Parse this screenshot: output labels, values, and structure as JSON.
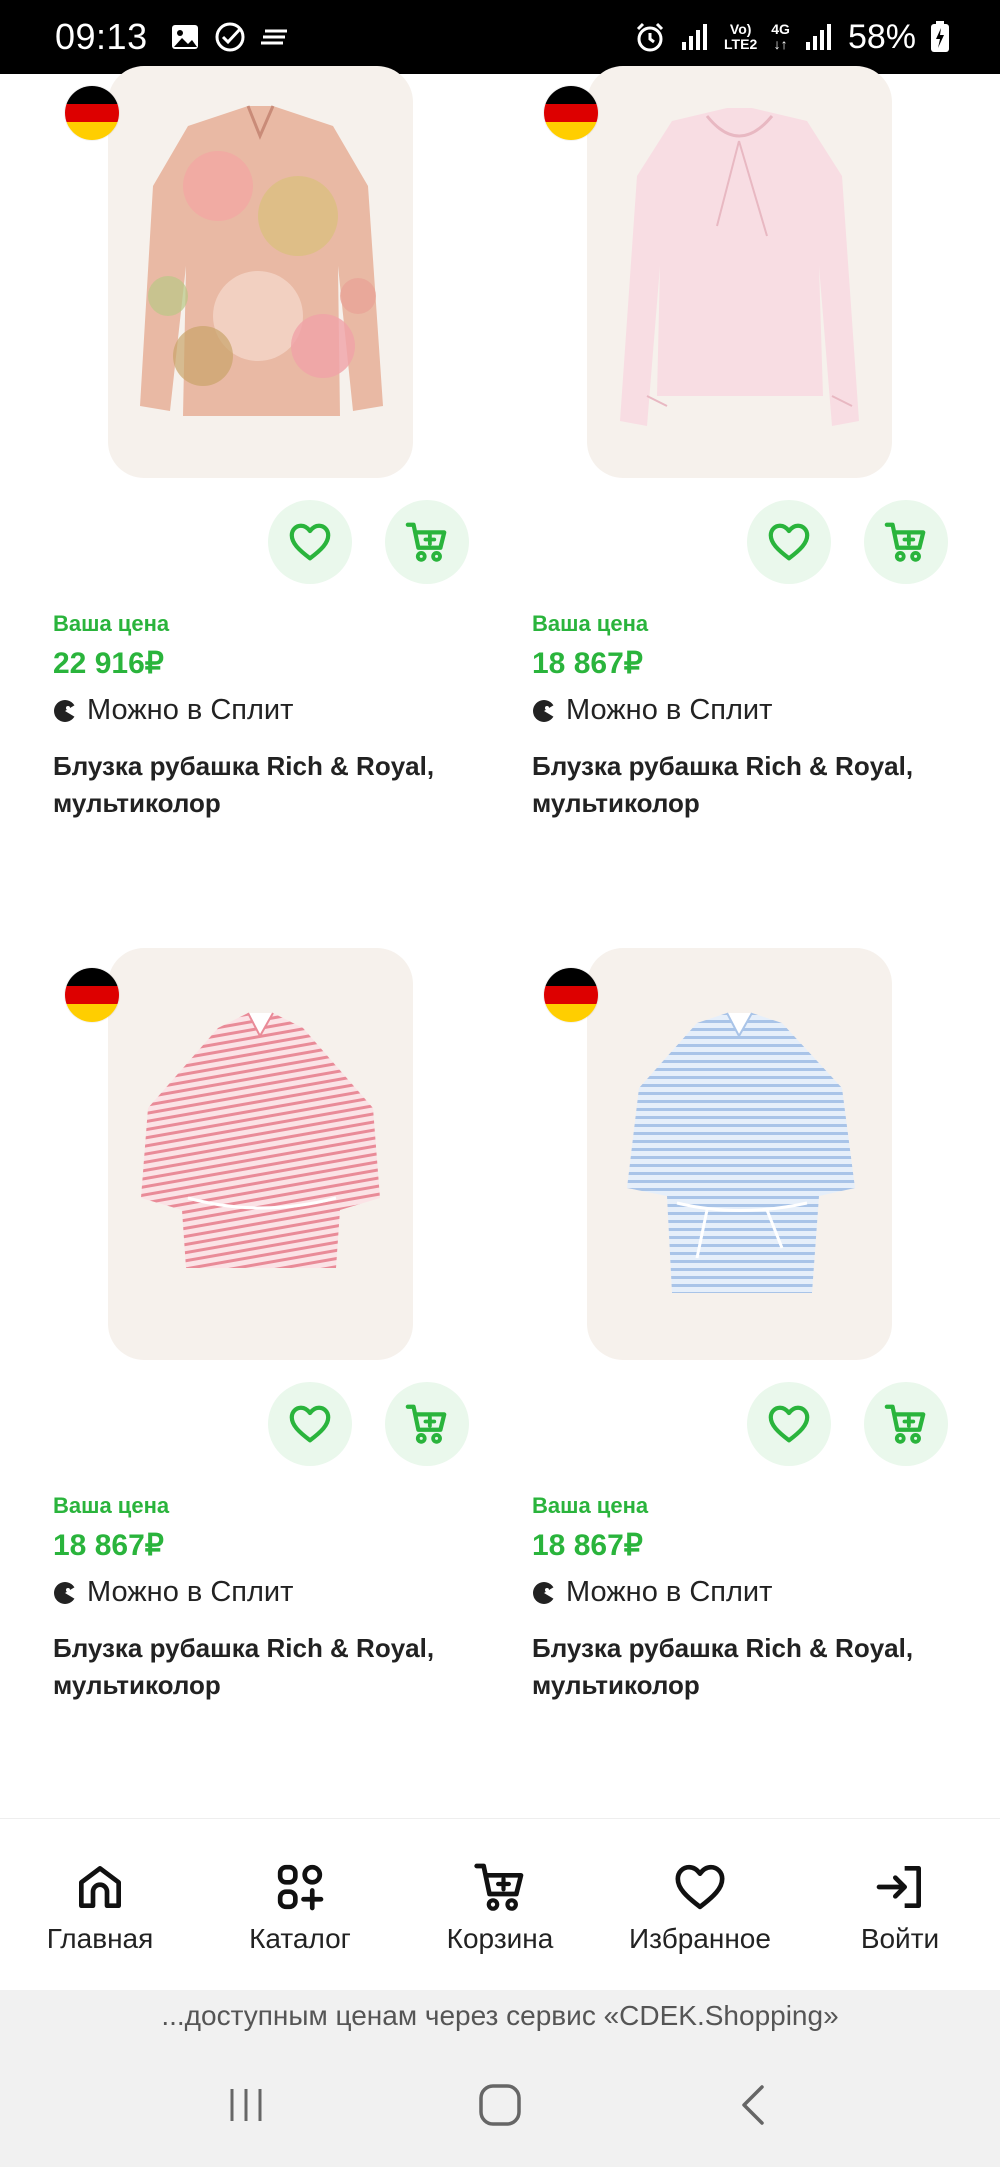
{
  "status_bar": {
    "time": "09:13",
    "battery": "58%",
    "network_top": "Vo)",
    "network_bottom": "LTE2",
    "network_gen": "4G"
  },
  "products": [
    {
      "price_label": "Ваша цена",
      "price": "22 916₽",
      "split_text": "Можно в Сплит",
      "title": "Блузка рубашка Rich & Royal, мультиколор",
      "origin_flag": "germany-flag",
      "image": "floral multicolor blouse"
    },
    {
      "price_label": "Ваша цена",
      "price": "18 867₽",
      "split_text": "Можно в Сплит",
      "title": "Блузка рубашка Rich & Royal, мультиколор",
      "origin_flag": "germany-flag",
      "image": "light pink blouse with tie neck"
    },
    {
      "price_label": "Ваша цена",
      "price": "18 867₽",
      "split_text": "Можно в Сплит",
      "title": "Блузка рубашка Rich & Royal, мультиколор",
      "origin_flag": "germany-flag",
      "image": "pink striped blouse"
    },
    {
      "price_label": "Ваша цена",
      "price": "18 867₽",
      "split_text": "Можно в Сплит",
      "title": "Блузка рубашка Rich & Royal, мультиколор",
      "origin_flag": "germany-flag",
      "image": "light blue striped blouse"
    }
  ],
  "bottom_nav": {
    "items": [
      {
        "label": "Главная",
        "icon": "home-icon"
      },
      {
        "label": "Каталог",
        "icon": "catalog-icon"
      },
      {
        "label": "Корзина",
        "icon": "cart-icon"
      },
      {
        "label": "Избранное",
        "icon": "heart-icon"
      },
      {
        "label": "Войти",
        "icon": "login-icon"
      }
    ]
  },
  "banner": {
    "text": "...доступным ценам через сервис «CDEK.Shopping»"
  },
  "colors": {
    "accent_green": "#2ab43c",
    "button_bg": "#eaf8ec",
    "card_bg": "#f6f1ec"
  }
}
